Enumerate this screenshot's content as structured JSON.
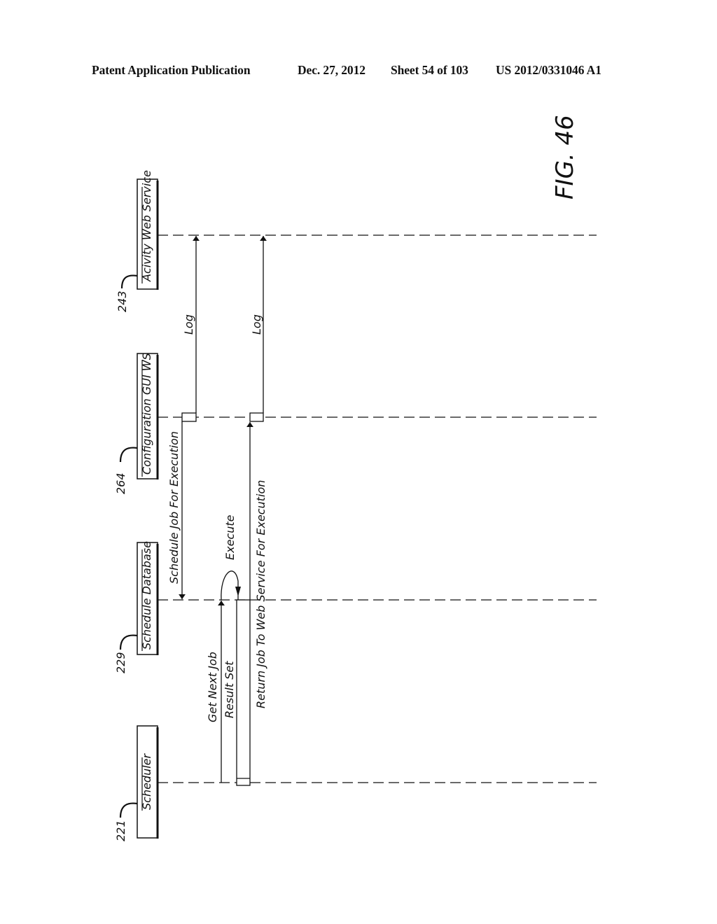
{
  "header": {
    "publication": "Patent Application Publication",
    "date": "Dec. 27, 2012",
    "sheet": "Sheet 54 of 103",
    "number": "US 2012/0331046 A1"
  },
  "figure": {
    "label": "FIG. 46",
    "type": "sequence-diagram"
  },
  "lifelines": [
    {
      "id": "activity",
      "name": "Acivity Web Service",
      "ref": "243"
    },
    {
      "id": "config",
      "name": "Configuration GUI WS",
      "ref": "264"
    },
    {
      "id": "scheddb",
      "name": "Schedule Database",
      "ref": "229"
    },
    {
      "id": "scheduler",
      "name": "Scheduler",
      "ref": "221"
    }
  ],
  "messages": [
    {
      "id": "get-next-job",
      "label": "Get Next Job",
      "from": "scheduler",
      "to": "scheddb",
      "order": 1
    },
    {
      "id": "execute",
      "label": "Execute",
      "from": "scheddb",
      "to": "scheddb",
      "order": 2,
      "self_call": true
    },
    {
      "id": "result-set",
      "label": "Result Set",
      "from": "scheddb",
      "to": "scheduler",
      "order": 3
    },
    {
      "id": "return-job",
      "label": "Return Job To Web Service For Execution",
      "from": "scheduler",
      "to": "config",
      "order": 4
    },
    {
      "id": "log-2",
      "label": "Log",
      "from": "config",
      "to": "activity",
      "order": 5
    },
    {
      "id": "schedule-job",
      "label": "Schedule Job For Execution",
      "from": "config",
      "to": "scheddb",
      "order": 6
    },
    {
      "id": "log-1",
      "label": "Log",
      "from": "config",
      "to": "activity",
      "order": 7
    }
  ]
}
